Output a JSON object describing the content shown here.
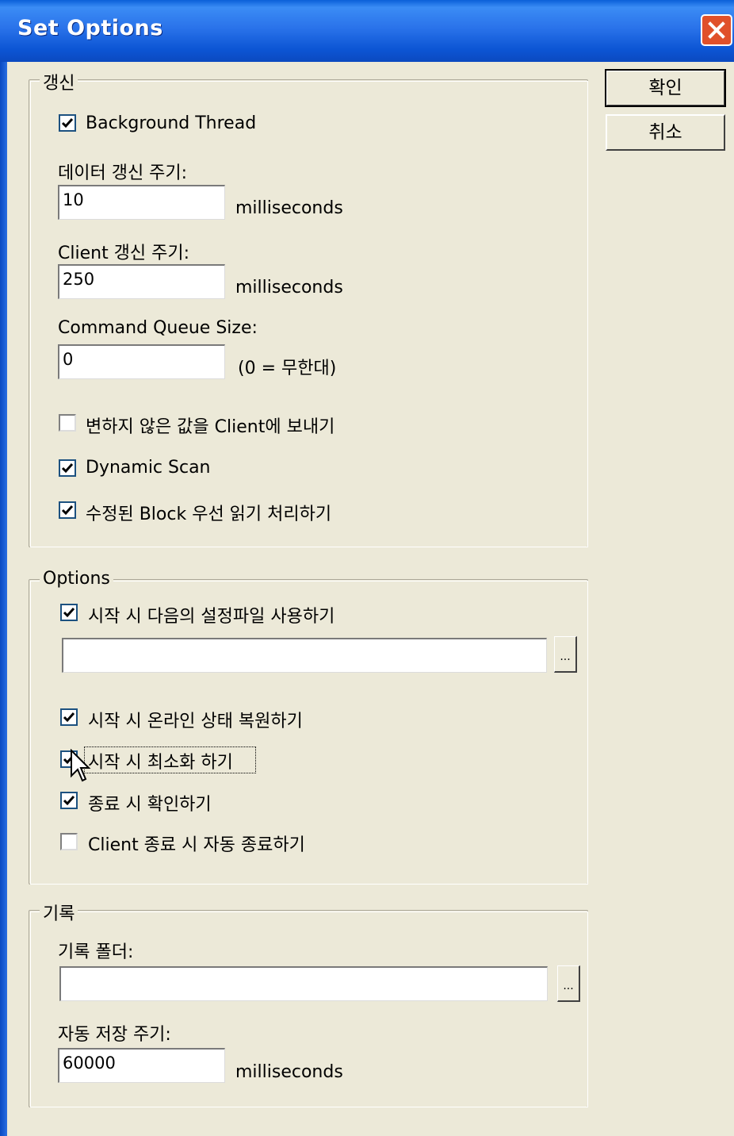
{
  "window": {
    "title": "Set Options"
  },
  "buttons": {
    "ok": "확인",
    "cancel": "취소"
  },
  "refresh": {
    "legend": "갱신",
    "background_thread": {
      "label": "Background Thread",
      "checked": true
    },
    "data_refresh": {
      "label": "데이터 갱신 주기:",
      "value": "10",
      "unit": "milliseconds"
    },
    "client_refresh": {
      "label": "Client 갱신 주기:",
      "value": "250",
      "unit": "milliseconds"
    },
    "queue_size": {
      "label": "Command Queue Size:",
      "value": "0",
      "hint": "(0 = 무한대)"
    },
    "send_unchanged": {
      "label": "변하지 않은 값을 Client에 보내기",
      "checked": false
    },
    "dynamic_scan": {
      "label": "Dynamic Scan",
      "checked": true
    },
    "modified_block": {
      "label": "수정된 Block 우선 읽기 처리하기",
      "checked": true
    }
  },
  "options": {
    "legend": "Options",
    "use_config": {
      "label": "시작 시 다음의 설정파일 사용하기",
      "checked": true,
      "path": "",
      "browse": "..."
    },
    "restore_online": {
      "label": "시작 시 온라인 상태 복원하기",
      "checked": true
    },
    "minimize": {
      "label": "시작 시 최소화 하기",
      "checked": true
    },
    "confirm_exit": {
      "label": "종료 시 확인하기",
      "checked": true
    },
    "auto_exit": {
      "label": "Client 종료 시 자동 종료하기",
      "checked": false
    }
  },
  "log": {
    "legend": "기록",
    "folder": {
      "label": "기록 폴더:",
      "value": "",
      "browse": "..."
    },
    "autosave": {
      "label": "자동 저장 주기:",
      "value": "60000",
      "unit": "milliseconds"
    }
  },
  "icons": {
    "close": "close-icon",
    "check": "checkmark-icon",
    "cursor": "mouse-pointer-icon"
  },
  "colors": {
    "title_bar": "#2a73ea",
    "close": "#e0502a",
    "dialog": "#ece9d8"
  }
}
